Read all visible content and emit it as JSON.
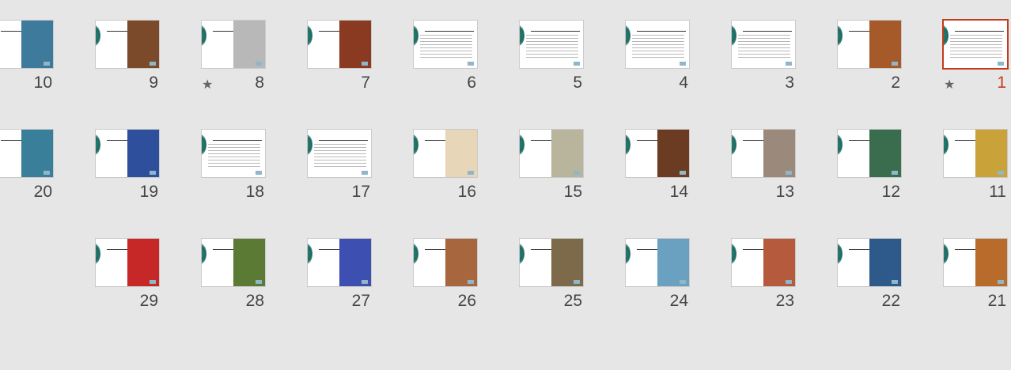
{
  "slides": [
    {
      "number": "10",
      "photo": "#3e7a9c",
      "star": false,
      "selected": false
    },
    {
      "number": "9",
      "photo": "#7a4a2a",
      "star": false,
      "selected": false
    },
    {
      "number": "8",
      "photo": "#b8b8b8",
      "star": true,
      "selected": false
    },
    {
      "number": "7",
      "photo": "#8a3a20",
      "star": false,
      "selected": false
    },
    {
      "number": "6",
      "photo": "#ffffff",
      "star": false,
      "selected": false
    },
    {
      "number": "5",
      "photo": "#ffffff",
      "star": false,
      "selected": false
    },
    {
      "number": "4",
      "photo": "#ffffff",
      "star": false,
      "selected": false
    },
    {
      "number": "3",
      "photo": "#ffffff",
      "star": false,
      "selected": false
    },
    {
      "number": "2",
      "photo": "#a65a2a",
      "star": false,
      "selected": false
    },
    {
      "number": "1",
      "photo": "#ffffff",
      "star": true,
      "selected": true
    },
    {
      "number": "20",
      "photo": "#3a7f9a",
      "star": false,
      "selected": false
    },
    {
      "number": "19",
      "photo": "#2e4f9b",
      "star": false,
      "selected": false
    },
    {
      "number": "18",
      "photo": "#ffffff",
      "star": false,
      "selected": false
    },
    {
      "number": "17",
      "photo": "#ffffff",
      "star": false,
      "selected": false
    },
    {
      "number": "16",
      "photo": "#e8d6b8",
      "star": false,
      "selected": false
    },
    {
      "number": "15",
      "photo": "#b9b59d",
      "star": false,
      "selected": false
    },
    {
      "number": "14",
      "photo": "#6b3b22",
      "star": false,
      "selected": false
    },
    {
      "number": "13",
      "photo": "#9b8a7c",
      "star": false,
      "selected": false
    },
    {
      "number": "12",
      "photo": "#3a6d4e",
      "star": false,
      "selected": false
    },
    {
      "number": "11",
      "photo": "#c9a23a",
      "star": false,
      "selected": false
    },
    {
      "number": "29",
      "photo": "#c62828",
      "star": false,
      "selected": false
    },
    {
      "number": "28",
      "photo": "#5b7a33",
      "star": false,
      "selected": false
    },
    {
      "number": "27",
      "photo": "#3d4fb1",
      "star": false,
      "selected": false
    },
    {
      "number": "26",
      "photo": "#a8663e",
      "star": false,
      "selected": false
    },
    {
      "number": "25",
      "photo": "#7d6a4a",
      "star": false,
      "selected": false
    },
    {
      "number": "24",
      "photo": "#6aa0c0",
      "star": false,
      "selected": false
    },
    {
      "number": "23",
      "photo": "#b55a3d",
      "star": false,
      "selected": false
    },
    {
      "number": "22",
      "photo": "#2d5a8a",
      "star": false,
      "selected": false
    },
    {
      "number": "21",
      "photo": "#b86b2a",
      "star": false,
      "selected": false
    }
  ],
  "star_glyph": "★"
}
